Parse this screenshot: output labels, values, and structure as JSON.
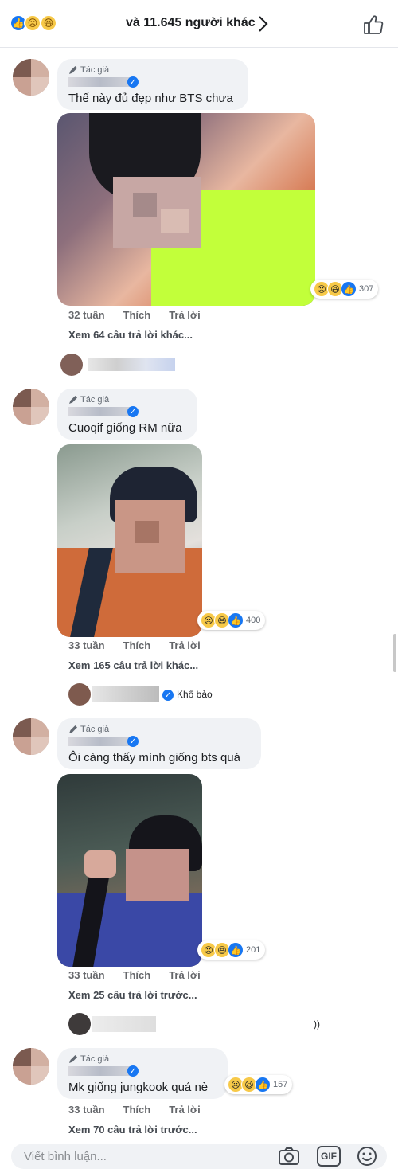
{
  "header": {
    "reaction_count": "và 11.645 người khác",
    "reactions": [
      "like",
      "sad",
      "haha"
    ]
  },
  "comments": [
    {
      "author_tag": "Tác giả",
      "text": "Thế này đủ đẹp như BTS chưa",
      "photo_reactions": "307",
      "time": "32 tuần",
      "like": "Thích",
      "reply": "Trả lời",
      "more": "Xem 64 câu trả lời khác..."
    },
    {
      "author_tag": "Tác giả",
      "text": "Cuoqif giống RM nữa",
      "photo_reactions": "400",
      "time": "33 tuần",
      "like": "Thích",
      "reply": "Trả lời",
      "more": "Xem 165 câu trả lời khác...",
      "reply_preview": "Khổ bảo"
    },
    {
      "author_tag": "Tác giả",
      "text": "Ôi càng thấy mình giống bts quá",
      "photo_reactions": "201",
      "time": "33 tuần",
      "like": "Thích",
      "reply": "Trả lời",
      "more": "Xem 25 câu trả lời trước...",
      "reply_preview": "))"
    },
    {
      "author_tag": "Tác giả",
      "text": "Mk giống jungkook quá nè",
      "reactions_count": "157",
      "time": "33 tuần",
      "like": "Thích",
      "reply": "Trả lời",
      "more": "Xem 70 câu trả lời trước..."
    }
  ],
  "composer": {
    "placeholder": "Viết bình luận...",
    "icons": [
      "camera-icon",
      "gif-icon",
      "emoji-icon"
    ],
    "gif_label": "GIF"
  },
  "colors": {
    "like_blue": "#1877f2",
    "bubble_bg": "#f0f2f5",
    "reaction_yellow": "#f7c948"
  }
}
